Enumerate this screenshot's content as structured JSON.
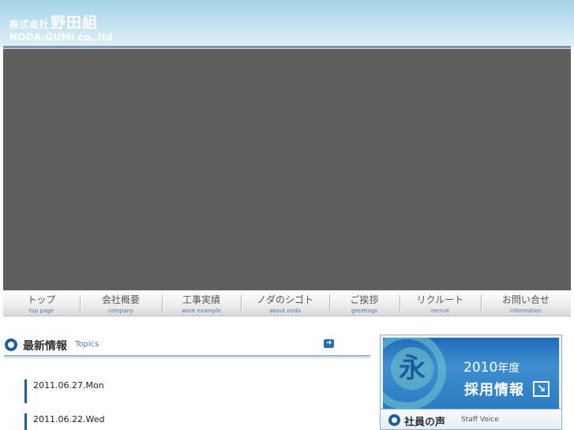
{
  "header": {
    "company_prefix": "株式会社",
    "company_name": "野田組",
    "company_en": "NODA-GUMI co.,ltd"
  },
  "nav": {
    "items": [
      {
        "jp": "トップ",
        "en": "top page"
      },
      {
        "jp": "会社概要",
        "en": "company"
      },
      {
        "jp": "工事実績",
        "en": "work example"
      },
      {
        "jp": "ノダのシゴト",
        "en": "about noda"
      },
      {
        "jp": "ご挨拶",
        "en": "greetings"
      },
      {
        "jp": "リクルート",
        "en": "recruit"
      },
      {
        "jp": "お問い合せ",
        "en": "information"
      }
    ]
  },
  "topics": {
    "title": "最新情報",
    "title_en": "Topics",
    "more_icon": "arrow-right-icon",
    "items": [
      {
        "date": "2011.06.27.Mon"
      },
      {
        "date": "2011.06.22.Wed"
      }
    ]
  },
  "recruit_banner": {
    "mark": "永",
    "year": "2010",
    "year_suffix": "年度",
    "title": "採用情報",
    "arrow": "↘"
  },
  "staff_voice": {
    "title": "社員の声",
    "title_en": "Staff Voice"
  },
  "colors": {
    "accent": "#1a5fa8",
    "hero_gray": "#5f5f5f",
    "header_sky": "#a9d3e8"
  }
}
